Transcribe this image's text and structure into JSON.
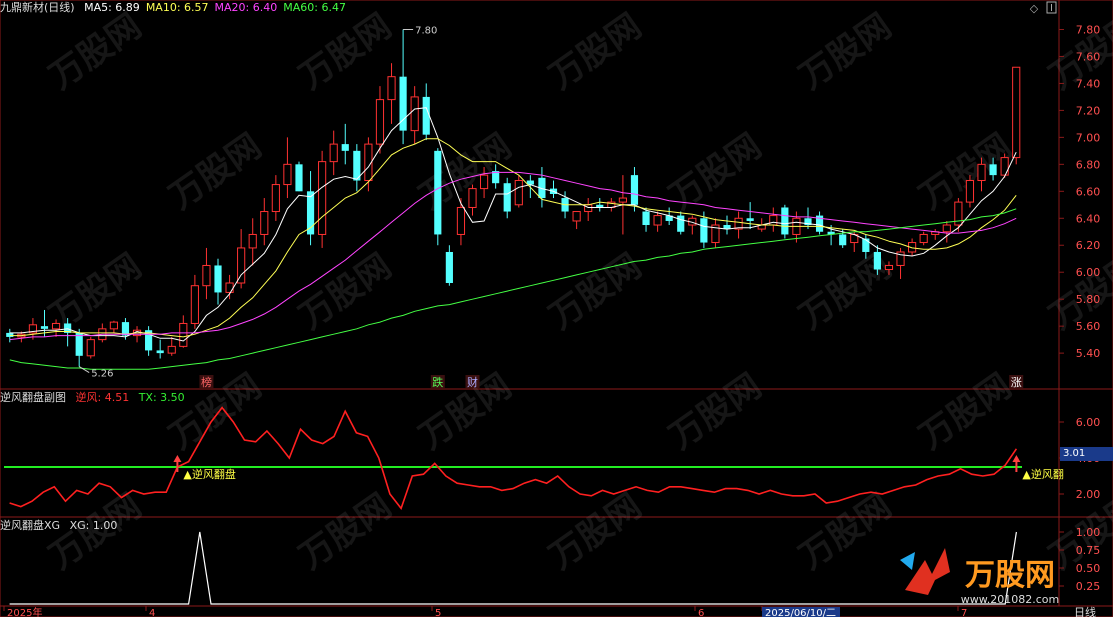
{
  "header": {
    "stock": "九鼎新材(日线)",
    "ma": [
      {
        "label": "MA5: 6.89",
        "color": "#ffffff"
      },
      {
        "label": "MA10: 6.57",
        "color": "#ffff55"
      },
      {
        "label": "MA20: 6.40",
        "color": "#ff44ff"
      },
      {
        "label": "MA60: 6.47",
        "color": "#44ff44"
      }
    ]
  },
  "sub1_header": {
    "title": "逆风翻盘副图",
    "nf": "逆风: 4.51",
    "tx": "TX: 3.50"
  },
  "sub2_header": {
    "title": "逆风翻盘XG",
    "xg": "XG: 1.00"
  },
  "annotations": {
    "high_label": "7.80",
    "low_label": "5.26",
    "signal_label": "逆风翻盘",
    "signal_label_right": "逆风翻",
    "axis_box_value": "3.01",
    "period_label": "日线"
  },
  "event_tags": [
    {
      "text": "榜",
      "color": "#ff6666"
    },
    {
      "text": "跌",
      "color": "#55ff55"
    },
    {
      "text": "财",
      "color": "#aaaaff"
    },
    {
      "text": "涨",
      "color": "#ffffff"
    }
  ],
  "date_axis": {
    "labels": [
      "2025年",
      "4",
      "5",
      "6",
      "2025/06/10/二",
      "7"
    ]
  },
  "watermark": {
    "text": "万股网",
    "url": "www.201082.com"
  },
  "chart_data": [
    {
      "type": "candlestick",
      "title": "九鼎新材(日线)",
      "ylim": [
        5.26,
        7.9
      ],
      "yticks": [
        5.4,
        5.6,
        5.8,
        6.0,
        6.2,
        6.4,
        6.6,
        6.8,
        7.0,
        7.2,
        7.4,
        7.6,
        7.8
      ],
      "up_color": "#ff3232",
      "down_color": "#54ffff",
      "ohlc": [
        [
          5.55,
          5.58,
          5.48,
          5.52
        ],
        [
          5.52,
          5.56,
          5.48,
          5.54
        ],
        [
          5.55,
          5.66,
          5.5,
          5.61
        ],
        [
          5.6,
          5.72,
          5.52,
          5.58
        ],
        [
          5.58,
          5.65,
          5.52,
          5.62
        ],
        [
          5.62,
          5.66,
          5.45,
          5.55
        ],
        [
          5.55,
          5.58,
          5.3,
          5.38
        ],
        [
          5.38,
          5.52,
          5.36,
          5.5
        ],
        [
          5.5,
          5.62,
          5.48,
          5.58
        ],
        [
          5.58,
          5.64,
          5.55,
          5.63
        ],
        [
          5.63,
          5.66,
          5.5,
          5.53
        ],
        [
          5.53,
          5.6,
          5.48,
          5.57
        ],
        [
          5.57,
          5.6,
          5.38,
          5.42
        ],
        [
          5.42,
          5.5,
          5.36,
          5.4
        ],
        [
          5.4,
          5.52,
          5.38,
          5.45
        ],
        [
          5.45,
          5.68,
          5.44,
          5.62
        ],
        [
          5.62,
          5.98,
          5.58,
          5.9
        ],
        [
          5.9,
          6.18,
          5.8,
          6.05
        ],
        [
          6.05,
          6.1,
          5.76,
          5.85
        ],
        [
          5.85,
          5.98,
          5.8,
          5.92
        ],
        [
          5.92,
          6.32,
          5.88,
          6.18
        ],
        [
          6.18,
          6.4,
          6.05,
          6.28
        ],
        [
          6.28,
          6.55,
          6.2,
          6.45
        ],
        [
          6.45,
          6.72,
          6.38,
          6.65
        ],
        [
          6.65,
          7.0,
          6.55,
          6.8
        ],
        [
          6.8,
          6.82,
          6.6,
          6.6
        ],
        [
          6.6,
          6.75,
          6.2,
          6.28
        ],
        [
          6.28,
          6.9,
          6.18,
          6.82
        ],
        [
          6.82,
          7.05,
          6.72,
          6.95
        ],
        [
          6.95,
          7.1,
          6.8,
          6.9
        ],
        [
          6.9,
          6.95,
          6.6,
          6.68
        ],
        [
          6.68,
          7.0,
          6.6,
          6.95
        ],
        [
          6.95,
          7.38,
          6.88,
          7.28
        ],
        [
          7.28,
          7.55,
          7.1,
          7.45
        ],
        [
          7.45,
          7.8,
          6.95,
          7.05
        ],
        [
          7.05,
          7.38,
          6.95,
          7.3
        ],
        [
          7.3,
          7.4,
          6.98,
          7.02
        ],
        [
          6.9,
          6.92,
          6.2,
          6.28
        ],
        [
          6.15,
          6.2,
          5.9,
          5.92
        ],
        [
          6.28,
          6.55,
          6.2,
          6.48
        ],
        [
          6.48,
          6.65,
          6.42,
          6.62
        ],
        [
          6.62,
          6.78,
          6.55,
          6.72
        ],
        [
          6.75,
          6.8,
          6.62,
          6.66
        ],
        [
          6.66,
          6.7,
          6.4,
          6.45
        ],
        [
          6.5,
          6.72,
          6.48,
          6.68
        ],
        [
          6.68,
          6.72,
          6.55,
          6.65
        ],
        [
          6.7,
          6.78,
          6.48,
          6.55
        ],
        [
          6.62,
          6.68,
          6.55,
          6.58
        ],
        [
          6.55,
          6.6,
          6.4,
          6.45
        ],
        [
          6.38,
          6.45,
          6.32,
          6.45
        ],
        [
          6.45,
          6.55,
          6.38,
          6.5
        ],
        [
          6.5,
          6.55,
          6.45,
          6.48
        ],
        [
          6.48,
          6.55,
          6.45,
          6.52
        ],
        [
          6.52,
          6.72,
          6.28,
          6.55
        ],
        [
          6.72,
          6.78,
          6.45,
          6.5
        ],
        [
          6.45,
          6.48,
          6.3,
          6.35
        ],
        [
          6.35,
          6.45,
          6.3,
          6.42
        ],
        [
          6.42,
          6.48,
          6.35,
          6.38
        ],
        [
          6.42,
          6.45,
          6.28,
          6.3
        ],
        [
          6.35,
          6.42,
          6.28,
          6.4
        ],
        [
          6.4,
          6.45,
          6.18,
          6.22
        ],
        [
          6.22,
          6.4,
          6.18,
          6.35
        ],
        [
          6.35,
          6.42,
          6.28,
          6.32
        ],
        [
          6.32,
          6.45,
          6.25,
          6.4
        ],
        [
          6.4,
          6.52,
          6.32,
          6.38
        ],
        [
          6.32,
          6.4,
          6.3,
          6.35
        ],
        [
          6.35,
          6.48,
          6.3,
          6.42
        ],
        [
          6.48,
          6.5,
          6.25,
          6.28
        ],
        [
          6.28,
          6.45,
          6.22,
          6.4
        ],
        [
          6.4,
          6.48,
          6.32,
          6.35
        ],
        [
          6.42,
          6.45,
          6.28,
          6.3
        ],
        [
          6.3,
          6.35,
          6.2,
          6.28
        ],
        [
          6.28,
          6.32,
          6.18,
          6.2
        ],
        [
          6.22,
          6.3,
          6.15,
          6.28
        ],
        [
          6.25,
          6.28,
          6.1,
          6.15
        ],
        [
          6.15,
          6.2,
          5.98,
          6.02
        ],
        [
          6.02,
          6.08,
          5.98,
          6.05
        ],
        [
          6.05,
          6.18,
          5.95,
          6.15
        ],
        [
          6.15,
          6.25,
          6.12,
          6.22
        ],
        [
          6.22,
          6.3,
          6.2,
          6.28
        ],
        [
          6.28,
          6.32,
          6.24,
          6.3
        ],
        [
          6.3,
          6.38,
          6.22,
          6.35
        ],
        [
          6.35,
          6.55,
          6.3,
          6.52
        ],
        [
          6.52,
          6.72,
          6.48,
          6.68
        ],
        [
          6.68,
          6.85,
          6.6,
          6.8
        ],
        [
          6.8,
          6.85,
          6.68,
          6.72
        ],
        [
          6.72,
          6.88,
          6.7,
          6.85
        ],
        [
          6.85,
          7.52,
          6.8,
          7.52
        ]
      ],
      "series": [
        {
          "name": "MA5",
          "color": "#ffffff",
          "values": [
            5.55,
            5.55,
            5.56,
            5.57,
            5.57,
            5.58,
            5.55,
            5.53,
            5.53,
            5.53,
            5.52,
            5.56,
            5.54,
            5.51,
            5.51,
            5.49,
            5.56,
            5.68,
            5.74,
            5.84,
            5.98,
            6.06,
            6.14,
            6.28,
            6.47,
            6.57,
            6.56,
            6.63,
            6.69,
            6.71,
            6.69,
            6.78,
            6.92,
            7.05,
            7.13,
            7.21,
            7.22,
            7.0,
            6.73,
            6.51,
            6.37,
            6.38,
            6.58,
            6.58,
            6.63,
            6.65,
            6.62,
            6.6,
            6.56,
            6.52,
            6.48,
            6.48,
            6.48,
            6.5,
            6.5,
            6.46,
            6.44,
            6.42,
            6.39,
            6.37,
            6.34,
            6.33,
            6.32,
            6.33,
            6.33,
            6.35,
            6.37,
            6.36,
            6.37,
            6.36,
            6.35,
            6.32,
            6.3,
            6.28,
            6.24,
            6.18,
            6.15,
            6.13,
            6.12,
            6.14,
            6.2,
            6.27,
            6.33,
            6.43,
            6.53,
            6.6,
            6.71,
            6.89
          ]
        },
        {
          "name": "MA10",
          "color": "#ffff55",
          "values": [
            5.53,
            5.53,
            5.54,
            5.55,
            5.56,
            5.56,
            5.55,
            5.55,
            5.55,
            5.55,
            5.54,
            5.55,
            5.55,
            5.54,
            5.53,
            5.52,
            5.54,
            5.57,
            5.6,
            5.66,
            5.74,
            5.81,
            5.91,
            6.01,
            6.15,
            6.28,
            6.33,
            6.41,
            6.48,
            6.55,
            6.59,
            6.67,
            6.77,
            6.87,
            6.92,
            6.95,
            6.99,
            6.99,
            6.94,
            6.87,
            6.82,
            6.82,
            6.82,
            6.77,
            6.72,
            6.63,
            6.54,
            6.52,
            6.5,
            6.5,
            6.5,
            6.52,
            6.51,
            6.5,
            6.49,
            6.47,
            6.46,
            6.45,
            6.44,
            6.43,
            6.41,
            6.39,
            6.38,
            6.37,
            6.36,
            6.35,
            6.35,
            6.34,
            6.34,
            6.34,
            6.34,
            6.33,
            6.32,
            6.31,
            6.28,
            6.26,
            6.23,
            6.21,
            6.18,
            6.17,
            6.17,
            6.18,
            6.21,
            6.26,
            6.33,
            6.39,
            6.46,
            6.57
          ]
        },
        {
          "name": "MA20",
          "color": "#ff44ff",
          "values": [
            5.5,
            5.51,
            5.52,
            5.52,
            5.53,
            5.53,
            5.53,
            5.53,
            5.54,
            5.54,
            5.54,
            5.54,
            5.54,
            5.54,
            5.55,
            5.55,
            5.55,
            5.56,
            5.57,
            5.59,
            5.62,
            5.65,
            5.69,
            5.74,
            5.8,
            5.86,
            5.91,
            5.97,
            6.03,
            6.09,
            6.16,
            6.23,
            6.3,
            6.37,
            6.44,
            6.51,
            6.57,
            6.62,
            6.66,
            6.69,
            6.71,
            6.73,
            6.74,
            6.74,
            6.74,
            6.73,
            6.72,
            6.7,
            6.68,
            6.66,
            6.64,
            6.62,
            6.61,
            6.59,
            6.58,
            6.56,
            6.55,
            6.53,
            6.52,
            6.51,
            6.5,
            6.48,
            6.47,
            6.46,
            6.45,
            6.44,
            6.43,
            6.42,
            6.41,
            6.41,
            6.4,
            6.39,
            6.38,
            6.37,
            6.36,
            6.35,
            6.34,
            6.33,
            6.32,
            6.31,
            6.3,
            6.29,
            6.29,
            6.3,
            6.31,
            6.33,
            6.36,
            6.4
          ]
        },
        {
          "name": "MA60",
          "color": "#44ff44",
          "values": [
            5.35,
            5.33,
            5.32,
            5.31,
            5.3,
            5.29,
            5.29,
            5.28,
            5.28,
            5.28,
            5.28,
            5.28,
            5.28,
            5.29,
            5.3,
            5.31,
            5.32,
            5.33,
            5.35,
            5.36,
            5.38,
            5.4,
            5.42,
            5.44,
            5.46,
            5.48,
            5.5,
            5.52,
            5.54,
            5.56,
            5.58,
            5.61,
            5.63,
            5.66,
            5.68,
            5.71,
            5.73,
            5.75,
            5.76,
            5.78,
            5.8,
            5.82,
            5.84,
            5.86,
            5.88,
            5.9,
            5.92,
            5.94,
            5.96,
            5.98,
            6.0,
            6.02,
            6.04,
            6.06,
            6.08,
            6.09,
            6.11,
            6.12,
            6.14,
            6.15,
            6.17,
            6.18,
            6.19,
            6.2,
            6.21,
            6.22,
            6.23,
            6.24,
            6.25,
            6.26,
            6.27,
            6.28,
            6.29,
            6.3,
            6.3,
            6.31,
            6.32,
            6.33,
            6.34,
            6.35,
            6.36,
            6.37,
            6.38,
            6.39,
            6.41,
            6.42,
            6.44,
            6.47
          ]
        }
      ]
    },
    {
      "type": "line",
      "title": "逆风翻盘副图",
      "ylim": [
        1.0,
        7.0
      ],
      "yticks": [
        2.0,
        4.0,
        6.0
      ],
      "series": [
        {
          "name": "逆风",
          "color": "#ff2020",
          "values": [
            1.5,
            1.3,
            1.6,
            2.1,
            2.4,
            1.6,
            2.2,
            2.0,
            2.6,
            2.4,
            1.8,
            2.2,
            2.0,
            2.1,
            2.1,
            3.5,
            3.8,
            4.9,
            6.0,
            6.8,
            6.0,
            5.0,
            4.9,
            5.5,
            4.8,
            4.0,
            5.6,
            5.0,
            4.8,
            5.2,
            6.6,
            5.4,
            5.2,
            4.0,
            2.0,
            1.2,
            3.0,
            3.1,
            3.7,
            3.0,
            2.6,
            2.5,
            2.4,
            2.4,
            2.2,
            2.3,
            2.6,
            2.8,
            2.6,
            3.0,
            2.4,
            2.0,
            1.9,
            2.2,
            2.0,
            2.2,
            2.4,
            2.2,
            2.1,
            2.4,
            2.4,
            2.3,
            2.2,
            2.1,
            2.3,
            2.3,
            2.2,
            2.0,
            2.2,
            2.0,
            1.9,
            1.9,
            2.0,
            1.5,
            1.6,
            1.8,
            2.0,
            2.1,
            2.0,
            2.2,
            2.4,
            2.5,
            2.8,
            3.0,
            3.1,
            3.4,
            3.1,
            3.0,
            3.1,
            3.6,
            4.51
          ]
        },
        {
          "name": "TX",
          "color": "#22ee22",
          "values": [
            3.5,
            3.5
          ]
        }
      ]
    },
    {
      "type": "line",
      "title": "逆风翻盘XG",
      "ylim": [
        0,
        1.0
      ],
      "yticks": [
        0.25,
        0.5,
        0.75,
        1.0
      ],
      "series": [
        {
          "name": "XG",
          "color": "#ffffff",
          "values": [
            0,
            0,
            0,
            0,
            0,
            0,
            0,
            0,
            0,
            0,
            0,
            0,
            0,
            0,
            0,
            0,
            0,
            1,
            0,
            0,
            0,
            0,
            0,
            0,
            0,
            0,
            0,
            0,
            0,
            0,
            0,
            0,
            0,
            0,
            0,
            0,
            0,
            0,
            0,
            0,
            0,
            0,
            0,
            0,
            0,
            0,
            0,
            0,
            0,
            0,
            0,
            0,
            0,
            0,
            0,
            0,
            0,
            0,
            0,
            0,
            0,
            0,
            0,
            0,
            0,
            0,
            0,
            0,
            0,
            0,
            0,
            0,
            0,
            0,
            0,
            0,
            0,
            0,
            0,
            0,
            0,
            0,
            0,
            0,
            0,
            0,
            0,
            0,
            0,
            0,
            1
          ]
        }
      ]
    }
  ]
}
